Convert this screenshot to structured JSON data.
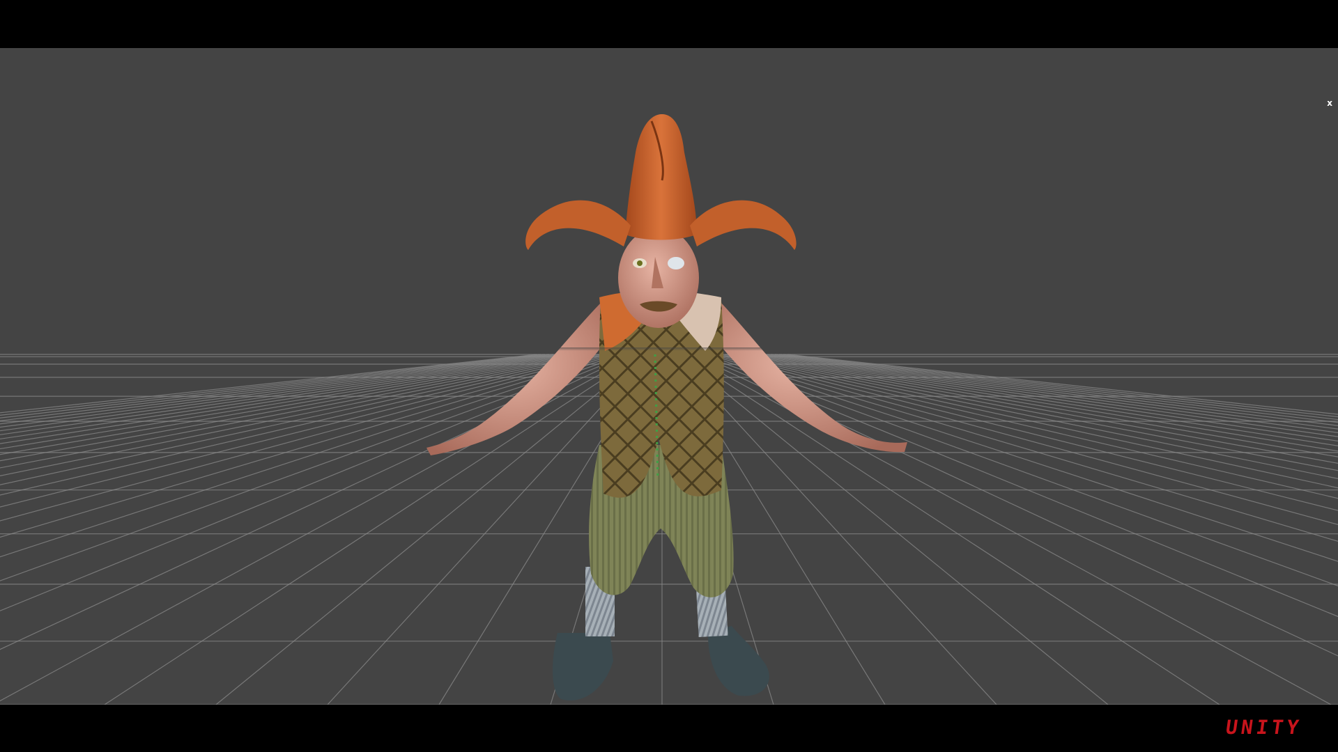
{
  "window": {
    "close_label": "x",
    "close_icon": "close-icon"
  },
  "viewport": {
    "background_color": "#444444",
    "grid_color": "#8a8a8a",
    "subject": "character-model"
  },
  "branding": {
    "text": "UNITY",
    "color": "#c8141c"
  }
}
